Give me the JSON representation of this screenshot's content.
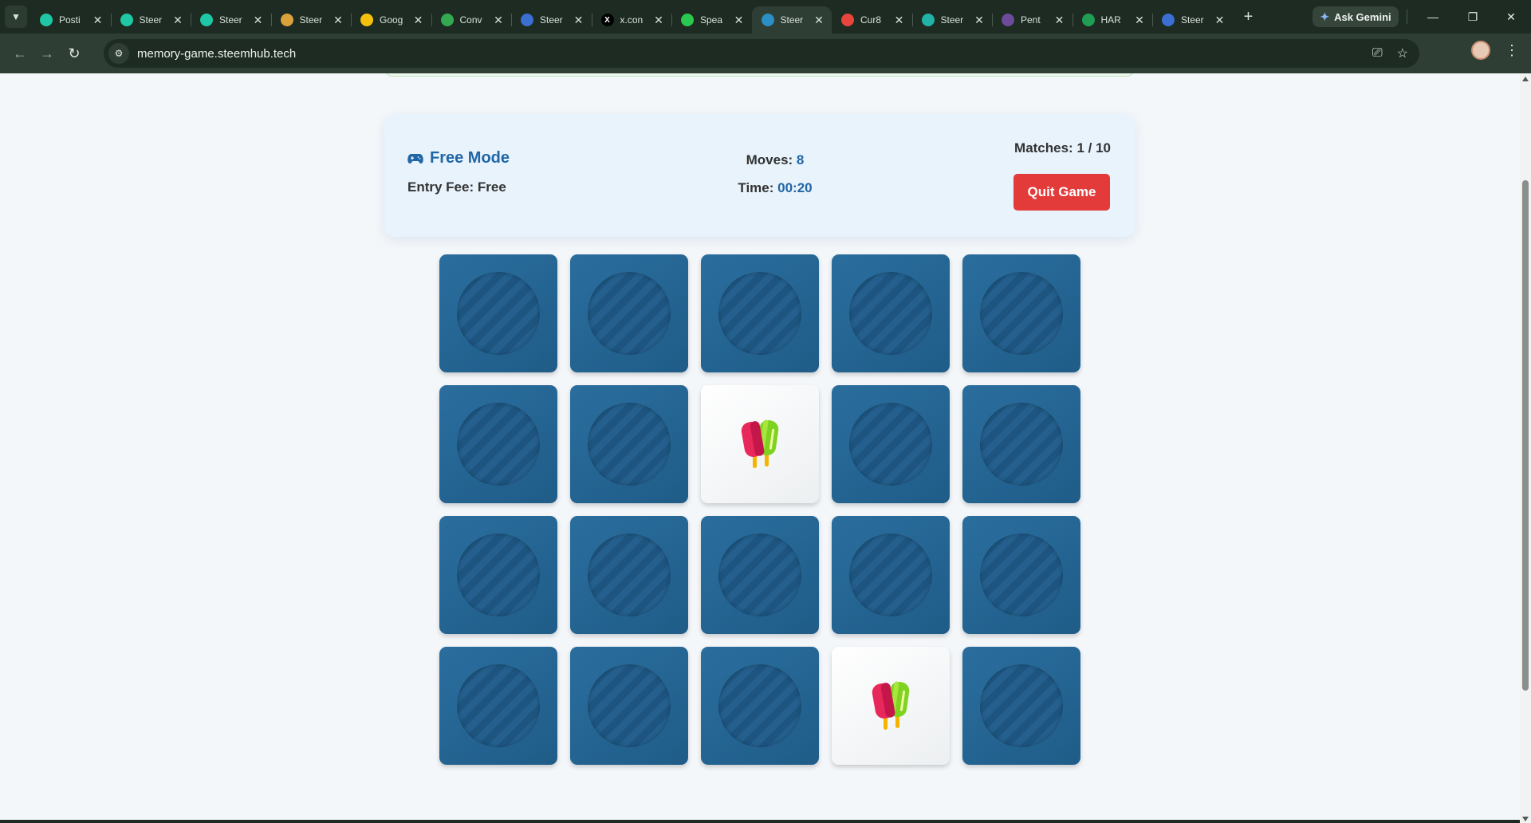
{
  "browser": {
    "tabs": [
      {
        "label": "Posti",
        "icon": "steem-icon",
        "color": "#1fc7a4"
      },
      {
        "label": "Steer",
        "icon": "steem-icon",
        "color": "#1fc7a4"
      },
      {
        "label": "Steer",
        "icon": "steem-icon",
        "color": "#1fc7a4"
      },
      {
        "label": "Steer",
        "icon": "avatar-icon",
        "color": "#d9a23a"
      },
      {
        "label": "Goog",
        "icon": "lightbulb-icon",
        "color": "#f4c20d"
      },
      {
        "label": "Conv",
        "icon": "drive-icon",
        "color": "#34a853"
      },
      {
        "label": "Steer",
        "icon": "globe-icon",
        "color": "#3b6fd1"
      },
      {
        "label": "x.con",
        "icon": "x-icon",
        "color": "#000000"
      },
      {
        "label": "Spea",
        "icon": "play-icon",
        "color": "#2ac94f"
      },
      {
        "label": "Steer",
        "icon": "globe-icon",
        "color": "#2a8fc4",
        "active": true
      },
      {
        "label": "Cur8",
        "icon": "cur8-icon",
        "color": "#e8453c"
      },
      {
        "label": "Steer",
        "icon": "swirl-icon",
        "color": "#22b3a6"
      },
      {
        "label": "Pent",
        "icon": "avatar-icon",
        "color": "#6b4b9a"
      },
      {
        "label": "HAR",
        "icon": "hive-icon",
        "color": "#1f9d55"
      },
      {
        "label": "Steer",
        "icon": "globe-icon",
        "color": "#3b6fd1"
      }
    ],
    "ask_gemini": "Ask Gemini",
    "url": "memory-game.steemhub.tech"
  },
  "game": {
    "mode_label": "Free Mode",
    "entry_fee_label": "Entry Fee: ",
    "entry_fee_value": "Free",
    "moves_label": "Moves: ",
    "moves_value": "8",
    "time_label": "Time: ",
    "time_value": "00:20",
    "matches_label": "Matches: ",
    "matches_value": "1 / 10",
    "quit_label": "Quit Game",
    "accent_color": "#2166a6",
    "quit_color": "#e33a3a",
    "card_back_color": "#256a9a"
  },
  "board": {
    "columns": 5,
    "rows": 4,
    "cards": [
      "hidden",
      "hidden",
      "hidden",
      "hidden",
      "hidden",
      "hidden",
      "hidden",
      "popsicle",
      "hidden",
      "hidden",
      "hidden",
      "hidden",
      "hidden",
      "hidden",
      "hidden",
      "hidden",
      "hidden",
      "hidden",
      "popsicle",
      "hidden"
    ]
  }
}
